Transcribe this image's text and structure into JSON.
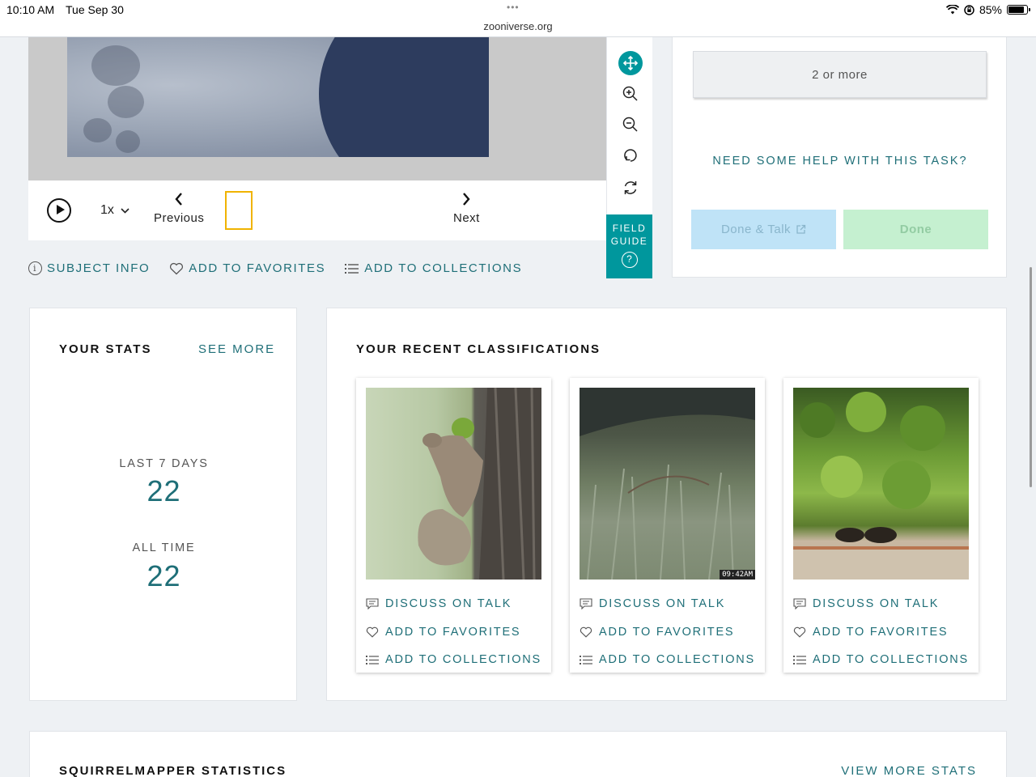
{
  "statusbar": {
    "time": "10:10 AM",
    "date": "Tue Sep 30",
    "dots": "•••",
    "url": "zooniverse.org",
    "battery": "85%"
  },
  "viewer": {
    "speed": "1x",
    "previous_label": "Previous",
    "next_label": "Next",
    "toolbar_icons": [
      "move-icon",
      "zoom-in-icon",
      "zoom-out-icon",
      "rotate-icon",
      "reset-icon"
    ],
    "field_guide_label": "FIELD GUIDE",
    "field_guide_help": "?"
  },
  "subject_links": {
    "info": "SUBJECT INFO",
    "favorites": "ADD TO FAVORITES",
    "collections": "ADD TO COLLECTIONS"
  },
  "task": {
    "answer": "2 or more",
    "help": "NEED SOME HELP WITH THIS TASK?",
    "done_talk": "Done & Talk",
    "done": "Done"
  },
  "stats": {
    "heading": "YOUR STATS",
    "see_more": "SEE MORE",
    "last7_label": "LAST 7 DAYS",
    "last7_value": "22",
    "alltime_label": "ALL TIME",
    "alltime_value": "22"
  },
  "recent": {
    "heading": "YOUR RECENT CLASSIFICATIONS",
    "cards": [
      {
        "talk": "DISCUSS ON TALK",
        "fav": "ADD TO FAVORITES",
        "coll": "ADD TO COLLECTIONS"
      },
      {
        "talk": "DISCUSS ON TALK",
        "fav": "ADD TO FAVORITES",
        "coll": "ADD TO COLLECTIONS",
        "timestamp": "09:42AM"
      },
      {
        "talk": "DISCUSS ON TALK",
        "fav": "ADD TO FAVORITES",
        "coll": "ADD TO COLLECTIONS"
      }
    ]
  },
  "project_stats": {
    "heading": "SQUIRRELMAPPER STATISTICS",
    "view_more": "VIEW MORE STATS"
  },
  "colors": {
    "teal": "#1f6f78",
    "accent": "#00979d",
    "frame_highlight": "#f0b300"
  }
}
